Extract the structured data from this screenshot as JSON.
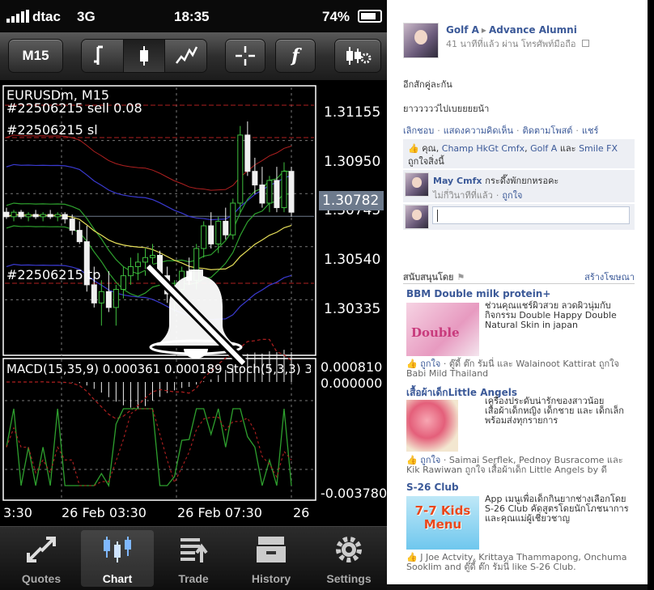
{
  "status": {
    "carrier": "dtac",
    "network": "3G",
    "time": "18:35",
    "battery": "74%"
  },
  "toolbar": {
    "timeframe": "M15",
    "line_icon": "line-chart-icon",
    "candle_icon": "candlestick-icon",
    "bar_icon": "bar-chart-icon",
    "crosshair_icon": "crosshair-icon",
    "indicator_label": "f",
    "settings_icon": "chart-settings-icon"
  },
  "chart": {
    "symbol": "EURUSDm, M15",
    "order1": "#22506215 sell 0.08",
    "order2": "#22506215 sl",
    "order3": "#22506215 tp",
    "current_price": "1.30782",
    "price_behind": "1.30745",
    "macd_header": "MACD(15,35,9) 0.000361 0.000189 Stoch(5,3,3) 36.36...",
    "macd_top": "0.000810",
    "macd_zero": "0.000000",
    "macd_bottom": "-0.003780",
    "time_axis": [
      "3:30",
      "26 Feb 03:30",
      "26 Feb 07:30",
      "26"
    ],
    "mute_icon": "mute-bell-icon",
    "colors": {
      "bull": "#3fbf3f",
      "bear": "#f0f0f0",
      "ma_yellow": "#e8e05a",
      "ma_green": "#2ea02e",
      "band_purple": "#3a3ad0",
      "band_red": "#b02020"
    }
  },
  "chart_data": {
    "type": "candlestick",
    "title": "EURUSDm, M15",
    "y_ticks": [
      "1.31155",
      "1.30950",
      "1.30745",
      "1.30540",
      "1.30335"
    ],
    "ylim": [
      1.3018,
      1.3135
    ],
    "x_labels": [
      "3:30",
      "26 Feb 03:30",
      "26 Feb 07:30",
      "26"
    ],
    "candles": [
      {
        "o": 1.308,
        "h": 1.3082,
        "l": 1.3077,
        "c": 1.3078
      },
      {
        "o": 1.3078,
        "h": 1.3081,
        "l": 1.3076,
        "c": 1.308
      },
      {
        "o": 1.308,
        "h": 1.3081,
        "l": 1.3077,
        "c": 1.3078
      },
      {
        "o": 1.3078,
        "h": 1.308,
        "l": 1.3076,
        "c": 1.3079
      },
      {
        "o": 1.3079,
        "h": 1.3081,
        "l": 1.3077,
        "c": 1.3078
      },
      {
        "o": 1.3078,
        "h": 1.308,
        "l": 1.3076,
        "c": 1.3079
      },
      {
        "o": 1.3079,
        "h": 1.3081,
        "l": 1.3077,
        "c": 1.3078
      },
      {
        "o": 1.3078,
        "h": 1.308,
        "l": 1.3076,
        "c": 1.3079
      },
      {
        "o": 1.3079,
        "h": 1.308,
        "l": 1.3075,
        "c": 1.3077
      },
      {
        "o": 1.3077,
        "h": 1.3079,
        "l": 1.307,
        "c": 1.3072
      },
      {
        "o": 1.3072,
        "h": 1.3076,
        "l": 1.3066,
        "c": 1.3067
      },
      {
        "o": 1.3067,
        "h": 1.3074,
        "l": 1.3045,
        "c": 1.3048
      },
      {
        "o": 1.3048,
        "h": 1.3056,
        "l": 1.3038,
        "c": 1.304
      },
      {
        "o": 1.304,
        "h": 1.305,
        "l": 1.303,
        "c": 1.3045
      },
      {
        "o": 1.3045,
        "h": 1.3054,
        "l": 1.3036,
        "c": 1.3038
      },
      {
        "o": 1.3038,
        "h": 1.3048,
        "l": 1.303,
        "c": 1.3046
      },
      {
        "o": 1.3046,
        "h": 1.3056,
        "l": 1.3042,
        "c": 1.3052
      },
      {
        "o": 1.3052,
        "h": 1.306,
        "l": 1.3048,
        "c": 1.3056
      },
      {
        "o": 1.3056,
        "h": 1.3062,
        "l": 1.305,
        "c": 1.3058
      },
      {
        "o": 1.3058,
        "h": 1.3064,
        "l": 1.3052,
        "c": 1.306
      },
      {
        "o": 1.306,
        "h": 1.3066,
        "l": 1.3055,
        "c": 1.3061
      },
      {
        "o": 1.3061,
        "h": 1.3063,
        "l": 1.305,
        "c": 1.3052
      },
      {
        "o": 1.3052,
        "h": 1.3056,
        "l": 1.304,
        "c": 1.3044
      },
      {
        "o": 1.3044,
        "h": 1.305,
        "l": 1.3036,
        "c": 1.3046
      },
      {
        "o": 1.3046,
        "h": 1.3056,
        "l": 1.304,
        "c": 1.3054
      },
      {
        "o": 1.3054,
        "h": 1.306,
        "l": 1.3048,
        "c": 1.305
      },
      {
        "o": 1.305,
        "h": 1.3066,
        "l": 1.3046,
        "c": 1.3064
      },
      {
        "o": 1.3064,
        "h": 1.3076,
        "l": 1.306,
        "c": 1.3074
      },
      {
        "o": 1.3074,
        "h": 1.308,
        "l": 1.3064,
        "c": 1.3066
      },
      {
        "o": 1.3066,
        "h": 1.3078,
        "l": 1.3062,
        "c": 1.3076
      },
      {
        "o": 1.3076,
        "h": 1.3082,
        "l": 1.3068,
        "c": 1.307
      },
      {
        "o": 1.307,
        "h": 1.3086,
        "l": 1.3068,
        "c": 1.3084
      },
      {
        "o": 1.3084,
        "h": 1.3118,
        "l": 1.308,
        "c": 1.3114
      },
      {
        "o": 1.3114,
        "h": 1.312,
        "l": 1.3096,
        "c": 1.3098
      },
      {
        "o": 1.3098,
        "h": 1.3104,
        "l": 1.3088,
        "c": 1.3092
      },
      {
        "o": 1.3092,
        "h": 1.31,
        "l": 1.3082,
        "c": 1.3084
      },
      {
        "o": 1.3084,
        "h": 1.3096,
        "l": 1.308,
        "c": 1.3094
      },
      {
        "o": 1.3094,
        "h": 1.31,
        "l": 1.308,
        "c": 1.3082
      },
      {
        "o": 1.3082,
        "h": 1.3102,
        "l": 1.308,
        "c": 1.3098
      },
      {
        "o": 1.3098,
        "h": 1.31,
        "l": 1.3078,
        "c": 1.308
      }
    ]
  },
  "tabs": [
    {
      "label": "Quotes",
      "icon": "quotes-icon"
    },
    {
      "label": "Chart",
      "icon": "chart-icon"
    },
    {
      "label": "Trade",
      "icon": "trade-icon"
    },
    {
      "label": "History",
      "icon": "history-icon"
    },
    {
      "label": "Settings",
      "icon": "settings-icon"
    }
  ],
  "facebook": {
    "author": "Golf A",
    "group": "Advance Alumni",
    "meta": "41 นาทีที่แล้ว ผ่าน โทรศัพท์มือถือ",
    "post_line1": "อีกสักคู่ละกัน",
    "post_line2": "ยาววววว่ไปเบยยยยน้า",
    "actions": [
      "เลิกชอบ",
      "แสดงความคิดเห็น",
      "ติดตามโพสต์",
      "แชร์"
    ],
    "likes_prefix": "คุณ,",
    "likes_user1": "Champ HkGt Cmfx",
    "likes_user2": "Golf A",
    "likes_and": "และ",
    "likes_user3": "Smile FX",
    "likes_suffix": "ถูกใจสิ่งนี้",
    "comment_author": "May Cmfx",
    "comment_text": "กระดึ๊งพักยกหรอคะ",
    "comment_time": "ไม่กี่วินาทีที่แล้ว",
    "comment_like": "ถูกใจ",
    "sponsor_label": "สนับสนุนโดย",
    "create_ad": "สร้างโฆษณา",
    "ads": [
      {
        "title": "BBM Double milk protein+",
        "desc": "ช่วนคุณแชร์ผิวสวย ลวดผิวนุ่มกับกิจกรรม Double Happy Double Natural Skin in japan",
        "like": "ถูกใจ",
        "social": "ตู๊ดี้ ต๊ก รัมนี่ และ Walainoot Kattirat ถูกใจ Babi Mild Thailand"
      },
      {
        "title": "เสื้อผ้าเด็กLittle Angels",
        "desc": "เครื่องประดับน่ารักของสาวน้อย เสื้อผ้าเด็กหญิง เด็กชาย และ เด็กเล็ก พร้อมส่งทุกรายการ",
        "like": "ถูกใจ",
        "social": "Saimai Serflek, Pednoy Busracome และ Kik Rawiwan ถูกใจ เสื้อผ้าเด็ก Little Angels by ดี"
      },
      {
        "title": "S-26 Club",
        "desc": "App เมนูเพื่อเด็กกินยากช่างเลือกโดย S-26 Club คัดสูตรโดยนักโภชนาการและคุณแม่ผู้เชี่ยวชาญ",
        "like": "ถูกใจ",
        "social": "J Joe Actvity, Krittaya Thammapong, Onchuma Sooklim and ตู๊ดี้ ต๊ก รัมนี่ like S-26 Club."
      }
    ],
    "ad_image_texts": [
      "Double",
      "7-7 Kids Menu"
    ]
  }
}
